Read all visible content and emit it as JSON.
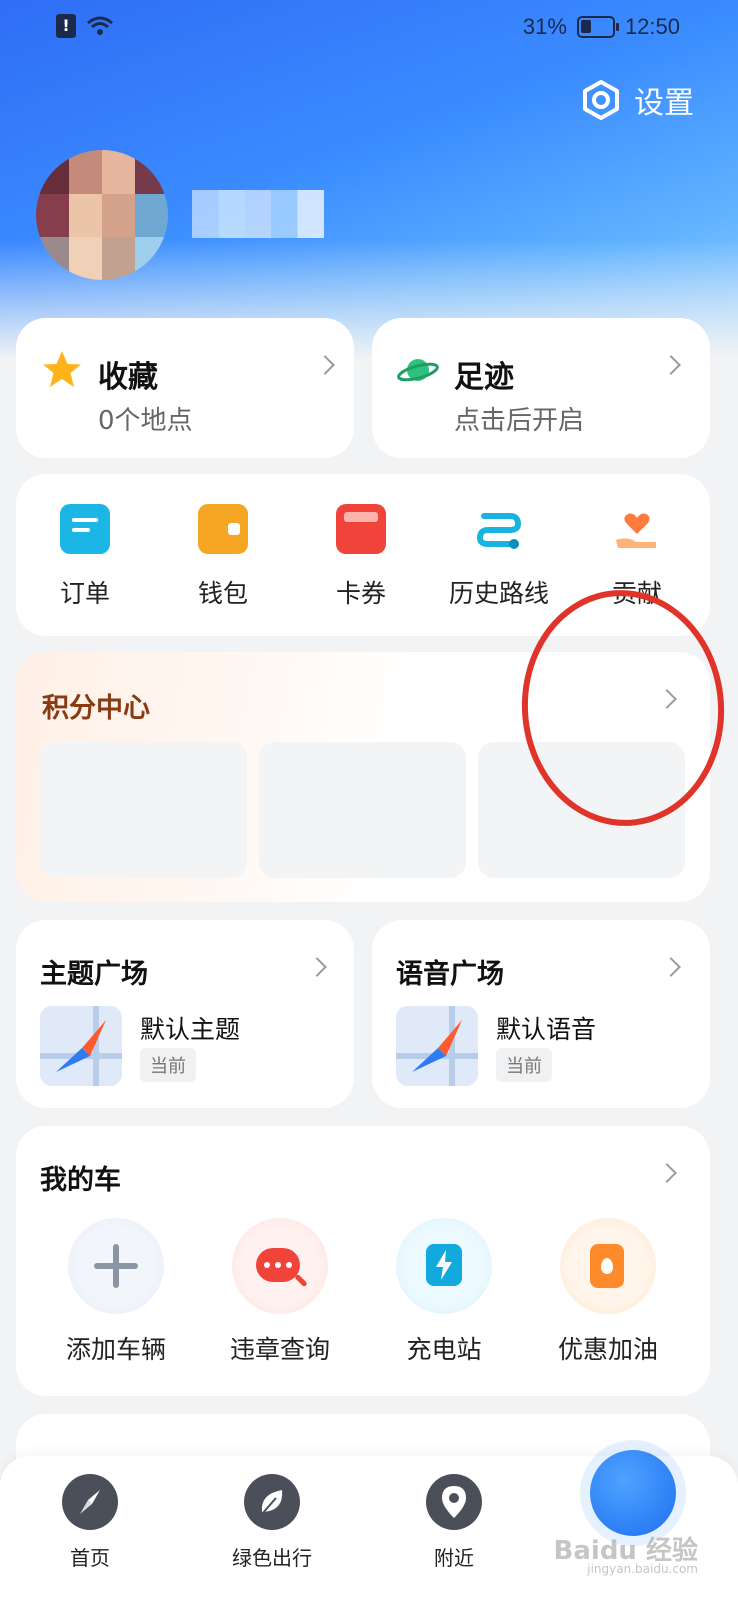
{
  "status_bar": {
    "battery": "31%",
    "time": "12:50",
    "sim_icon": "sim-alert-icon",
    "wifi_icon": "wifi-icon"
  },
  "header": {
    "settings_label": "设置",
    "settings_icon": "hexagon-gear-icon"
  },
  "quick_cards": [
    {
      "title": "收藏",
      "subtitle": "0个地点",
      "icon": "star-icon"
    },
    {
      "title": "足迹",
      "subtitle": "点击后开启",
      "icon": "planet-icon"
    }
  ],
  "tools": [
    {
      "label": "订单",
      "icon": "order-icon",
      "color": "#1bb6e6"
    },
    {
      "label": "钱包",
      "icon": "wallet-icon",
      "color": "#f5a623"
    },
    {
      "label": "卡券",
      "icon": "coupon-icon",
      "color": "#f0443b"
    },
    {
      "label": "历史路线",
      "icon": "route-history-icon",
      "color": "#19b3e0"
    },
    {
      "label": "贡献",
      "icon": "contribute-icon",
      "color": "#ff7a3d"
    }
  ],
  "points": {
    "title": "积分中心"
  },
  "squares": [
    {
      "title": "主题广场",
      "name": "默认主题",
      "tag": "当前",
      "icon": "compass-thumb-icon"
    },
    {
      "title": "语音广场",
      "name": "默认语音",
      "tag": "当前",
      "icon": "compass-thumb-icon"
    }
  ],
  "my_car": {
    "title": "我的车",
    "items": [
      {
        "label": "添加车辆",
        "icon": "plus-icon"
      },
      {
        "label": "违章查询",
        "icon": "violation-search-icon"
      },
      {
        "label": "充电站",
        "icon": "charging-station-icon"
      },
      {
        "label": "优惠加油",
        "icon": "fuel-discount-icon"
      }
    ]
  },
  "bottom_nav": [
    {
      "label": "首页",
      "icon": "compass-nav-icon"
    },
    {
      "label": "绿色出行",
      "icon": "leaf-icon"
    },
    {
      "label": "附近",
      "icon": "location-pin-icon"
    }
  ],
  "watermark": {
    "text": "Baidu 经验",
    "sub": "jingyan.baidu.com"
  }
}
